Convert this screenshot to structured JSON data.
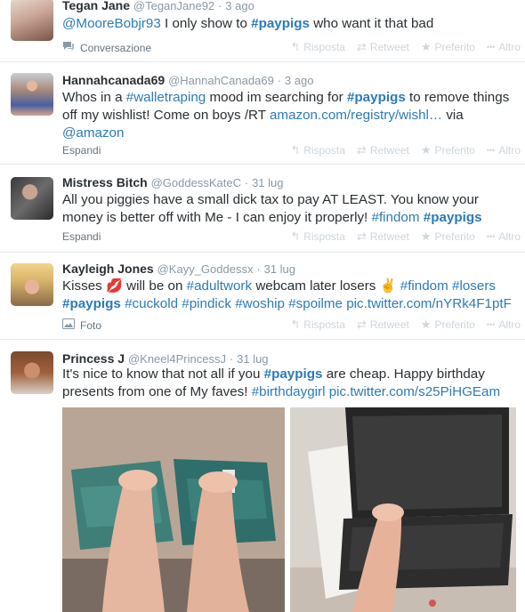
{
  "actions": {
    "reply": "Risposta",
    "retweet": "Retweet",
    "favorite": "Preferito",
    "more": "Altro"
  },
  "tweets": [
    {
      "name": "Tegan Jane",
      "handle": "@TeganJane92",
      "time": "3 ago",
      "text": [
        {
          "t": "@MooreBobjr93",
          "k": "mention"
        },
        {
          "t": " I only show to ",
          "k": "plain"
        },
        {
          "t": "#paypigs",
          "k": "tagb"
        },
        {
          "t": " who want it that bad",
          "k": "plain"
        }
      ],
      "footer_label": "Conversazione",
      "footer_icon": "conversation-icon"
    },
    {
      "name": "Hannahcanada69",
      "handle": "@HannahCanada69",
      "time": "3 ago",
      "text": [
        {
          "t": "Whos in a ",
          "k": "plain"
        },
        {
          "t": "#walletraping",
          "k": "tag"
        },
        {
          "t": " mood im searching for ",
          "k": "plain"
        },
        {
          "t": "#paypigs",
          "k": "tagb"
        },
        {
          "t": " to remove things off my wishlist! Come on boys /RT ",
          "k": "plain"
        },
        {
          "t": "amazon.com/registry/wishl…",
          "k": "link"
        },
        {
          "t": " via ",
          "k": "plain"
        },
        {
          "t": "@amazon",
          "k": "mention"
        }
      ],
      "footer_label": "Espandi",
      "footer_icon": ""
    },
    {
      "name": "Mistress Bitch",
      "handle": "@GoddessKateC",
      "time": "31 lug",
      "text": [
        {
          "t": "All you piggies have a small dick tax to pay AT LEAST. You know your money is better off with Me - I can enjoy it properly! ",
          "k": "plain"
        },
        {
          "t": "#findom",
          "k": "tag"
        },
        {
          "t": " ",
          "k": "plain"
        },
        {
          "t": "#paypigs",
          "k": "tagb"
        }
      ],
      "footer_label": "Espandi",
      "footer_icon": ""
    },
    {
      "name": "Kayleigh Jones",
      "handle": "@Kayy_Goddessx",
      "time": "31 lug",
      "text": [
        {
          "t": "Kisses ",
          "k": "plain"
        },
        {
          "t": "💋",
          "k": "emoji"
        },
        {
          "t": " will be on ",
          "k": "plain"
        },
        {
          "t": "#adultwork",
          "k": "tag"
        },
        {
          "t": " webcam later losers ",
          "k": "plain"
        },
        {
          "t": "✌",
          "k": "emoji"
        },
        {
          "t": " ",
          "k": "plain"
        },
        {
          "t": "#findom",
          "k": "tag"
        },
        {
          "t": " ",
          "k": "plain"
        },
        {
          "t": "#losers",
          "k": "tag"
        },
        {
          "t": " ",
          "k": "plain"
        },
        {
          "t": "#paypigs",
          "k": "tagb"
        },
        {
          "t": " ",
          "k": "plain"
        },
        {
          "t": "#cuckold",
          "k": "tag"
        },
        {
          "t": " ",
          "k": "plain"
        },
        {
          "t": "#pindick",
          "k": "tag"
        },
        {
          "t": " ",
          "k": "plain"
        },
        {
          "t": "#woship",
          "k": "tag"
        },
        {
          "t": " ",
          "k": "plain"
        },
        {
          "t": "#spoilme",
          "k": "tag"
        },
        {
          "t": " ",
          "k": "plain"
        },
        {
          "t": "pic.twitter.com/nYRk4F1ptF",
          "k": "link"
        }
      ],
      "footer_label": "Foto",
      "footer_icon": "photo-icon"
    },
    {
      "name": "Princess J",
      "handle": "@Kneel4PrincessJ",
      "time": "31 lug",
      "text": [
        {
          "t": "It's nice to know that not all if you ",
          "k": "plain"
        },
        {
          "t": "#paypigs",
          "k": "tagb"
        },
        {
          "t": " are cheap. Happy birthday presents from one of My faves! ",
          "k": "plain"
        },
        {
          "t": "#birthdaygirl",
          "k": "tag"
        },
        {
          "t": " ",
          "k": "plain"
        },
        {
          "t": "pic.twitter.com/s25PiHGEam",
          "k": "link"
        }
      ],
      "footer_label": "",
      "footer_icon": ""
    }
  ]
}
